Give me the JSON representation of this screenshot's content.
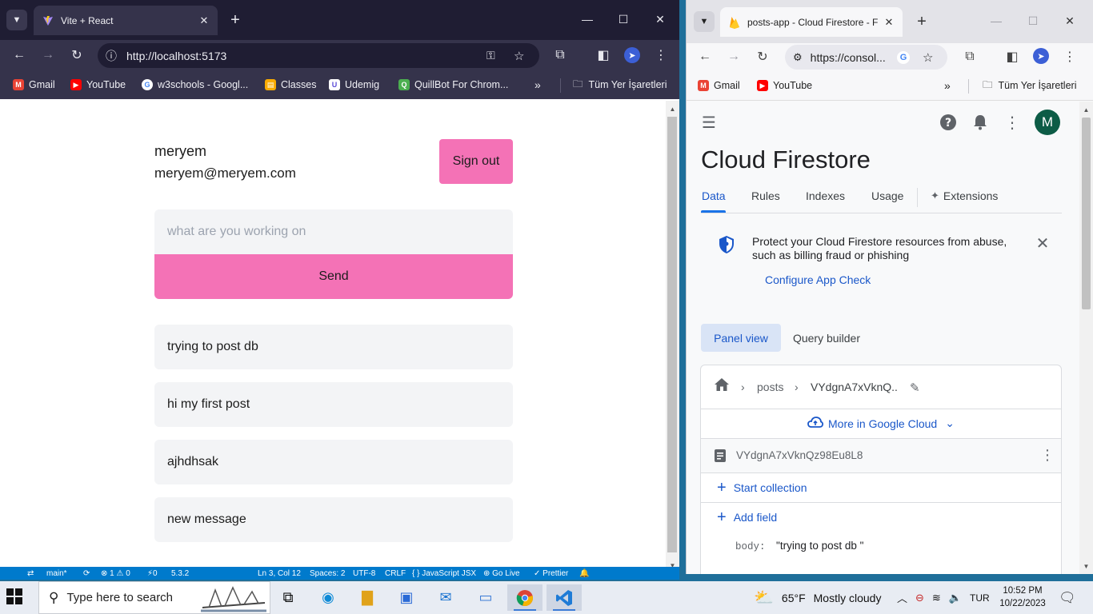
{
  "left_window": {
    "tab_title": "Vite + React",
    "url": "http://localhost:5173",
    "bookmarks": [
      "Gmail",
      "YouTube",
      "w3schools - Googl...",
      "Classes",
      "Udemig",
      "QuillBot For Chrom..."
    ],
    "all_bookmarks_label": "Tüm Yer İşaretleri"
  },
  "app": {
    "user_name": "meryem",
    "user_email": "meryem@meryem.com",
    "sign_out_label": "Sign out",
    "input_placeholder": "what are you working on",
    "send_label": "Send",
    "posts": [
      "trying to post db",
      "hi my first post",
      "ajhdhsak",
      "new message"
    ],
    "accent_color": "#f472b6"
  },
  "vscode_status": {
    "branch": "main*",
    "problems": "⊗ 1 ⚠ 0",
    "ports": "⚡0",
    "version": "5.3.2",
    "position": "Ln 3, Col 12",
    "spaces": "Spaces: 2",
    "encoding": "UTF-8",
    "eol": "CRLF",
    "language": "{ } JavaScript JSX",
    "golive": "⊕ Go Live",
    "prettier": "✓ Prettier"
  },
  "right_window": {
    "tab_title": "posts-app - Cloud Firestore - F",
    "url": "https://consol...",
    "bookmarks": [
      "Gmail",
      "YouTube"
    ],
    "all_bookmarks_label": "Tüm Yer İşaretleri"
  },
  "firestore": {
    "title": "Cloud Firestore",
    "avatar_letter": "M",
    "tabs": [
      "Data",
      "Rules",
      "Indexes",
      "Usage",
      "Extensions"
    ],
    "banner_text": "Protect your Cloud Firestore resources from abuse, such as billing fraud or phishing",
    "banner_link": "Configure App Check",
    "view_panel": "Panel view",
    "view_query": "Query builder",
    "breadcrumb_collection": "posts",
    "breadcrumb_doc": "VYdgnA7xVknQ..",
    "more_label": "More in Google Cloud",
    "doc_id": "VYdgnA7xVknQz98Eu8L8",
    "start_collection": "Start collection",
    "add_field": "Add field",
    "field_key": "body",
    "field_value": "\"trying to post db \""
  },
  "taskbar": {
    "search_placeholder": "Type here to search",
    "weather_temp": "65°F",
    "weather_desc": "Mostly cloudy",
    "language": "TUR",
    "time": "10:52 PM",
    "date": "10/22/2023"
  }
}
